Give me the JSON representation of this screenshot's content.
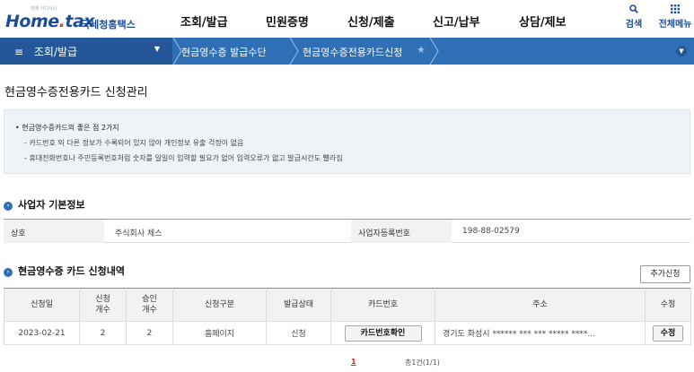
{
  "header": {
    "logo_small": "언제 어디서나",
    "logo_word_a": "Home",
    "logo_word_b": "tax",
    "logo_suffix": "국세청홈택스",
    "menu": [
      "조회/발급",
      "민원증명",
      "신청/제출",
      "신고/납부",
      "상담/제보"
    ],
    "search_label": "검색",
    "allmenu_label": "전체메뉴"
  },
  "navbar": {
    "menu_label": "조회/발급",
    "crumbs": [
      "현금영수증 발급수단",
      "현금영수증전용카드신청"
    ]
  },
  "page": {
    "title": "현금영수증전용카드 신청관리",
    "info": {
      "title": "현금영수증카드의 좋은 점 2가지",
      "line1": "카드번호 외 다른 정보가 수록되어 있지 않아 개인정보 유출 걱정이 없음",
      "line2": "휴대전화번호나 주민등록번호처럼 숫자를 일일이 입력할 필요가 없어 입력오류가 없고 발급시간도 빨라짐"
    }
  },
  "business": {
    "section_title": "사업자 기본정보",
    "name_label": "상호",
    "name_value": "주식회사 체스",
    "regno_label": "사업자등록번호",
    "regno_value": "198-88-02579"
  },
  "apply_list": {
    "section_title": "현금영수증 카드 신청내역",
    "add_button": "추가신청",
    "columns": [
      "신청일",
      "신청\n개수",
      "승인\n개수",
      "신청구분",
      "발급상태",
      "카드번호",
      "주소",
      "수정"
    ],
    "rows": [
      {
        "date": "2023-02-21",
        "req_count": "2",
        "approved_count": "2",
        "type": "홈페이지",
        "status": "신청",
        "card_button": "카드번호확인",
        "address": "경기도 화성시 ****** *** *** ***** ****...",
        "edit_button": "수정"
      }
    ]
  },
  "pager": {
    "current": "1",
    "total": "총1건(1/1)"
  },
  "colors": {
    "brand_blue": "#2f6fb5",
    "brand_dark_blue": "#24569a",
    "accent_red": "#e03a3a"
  }
}
